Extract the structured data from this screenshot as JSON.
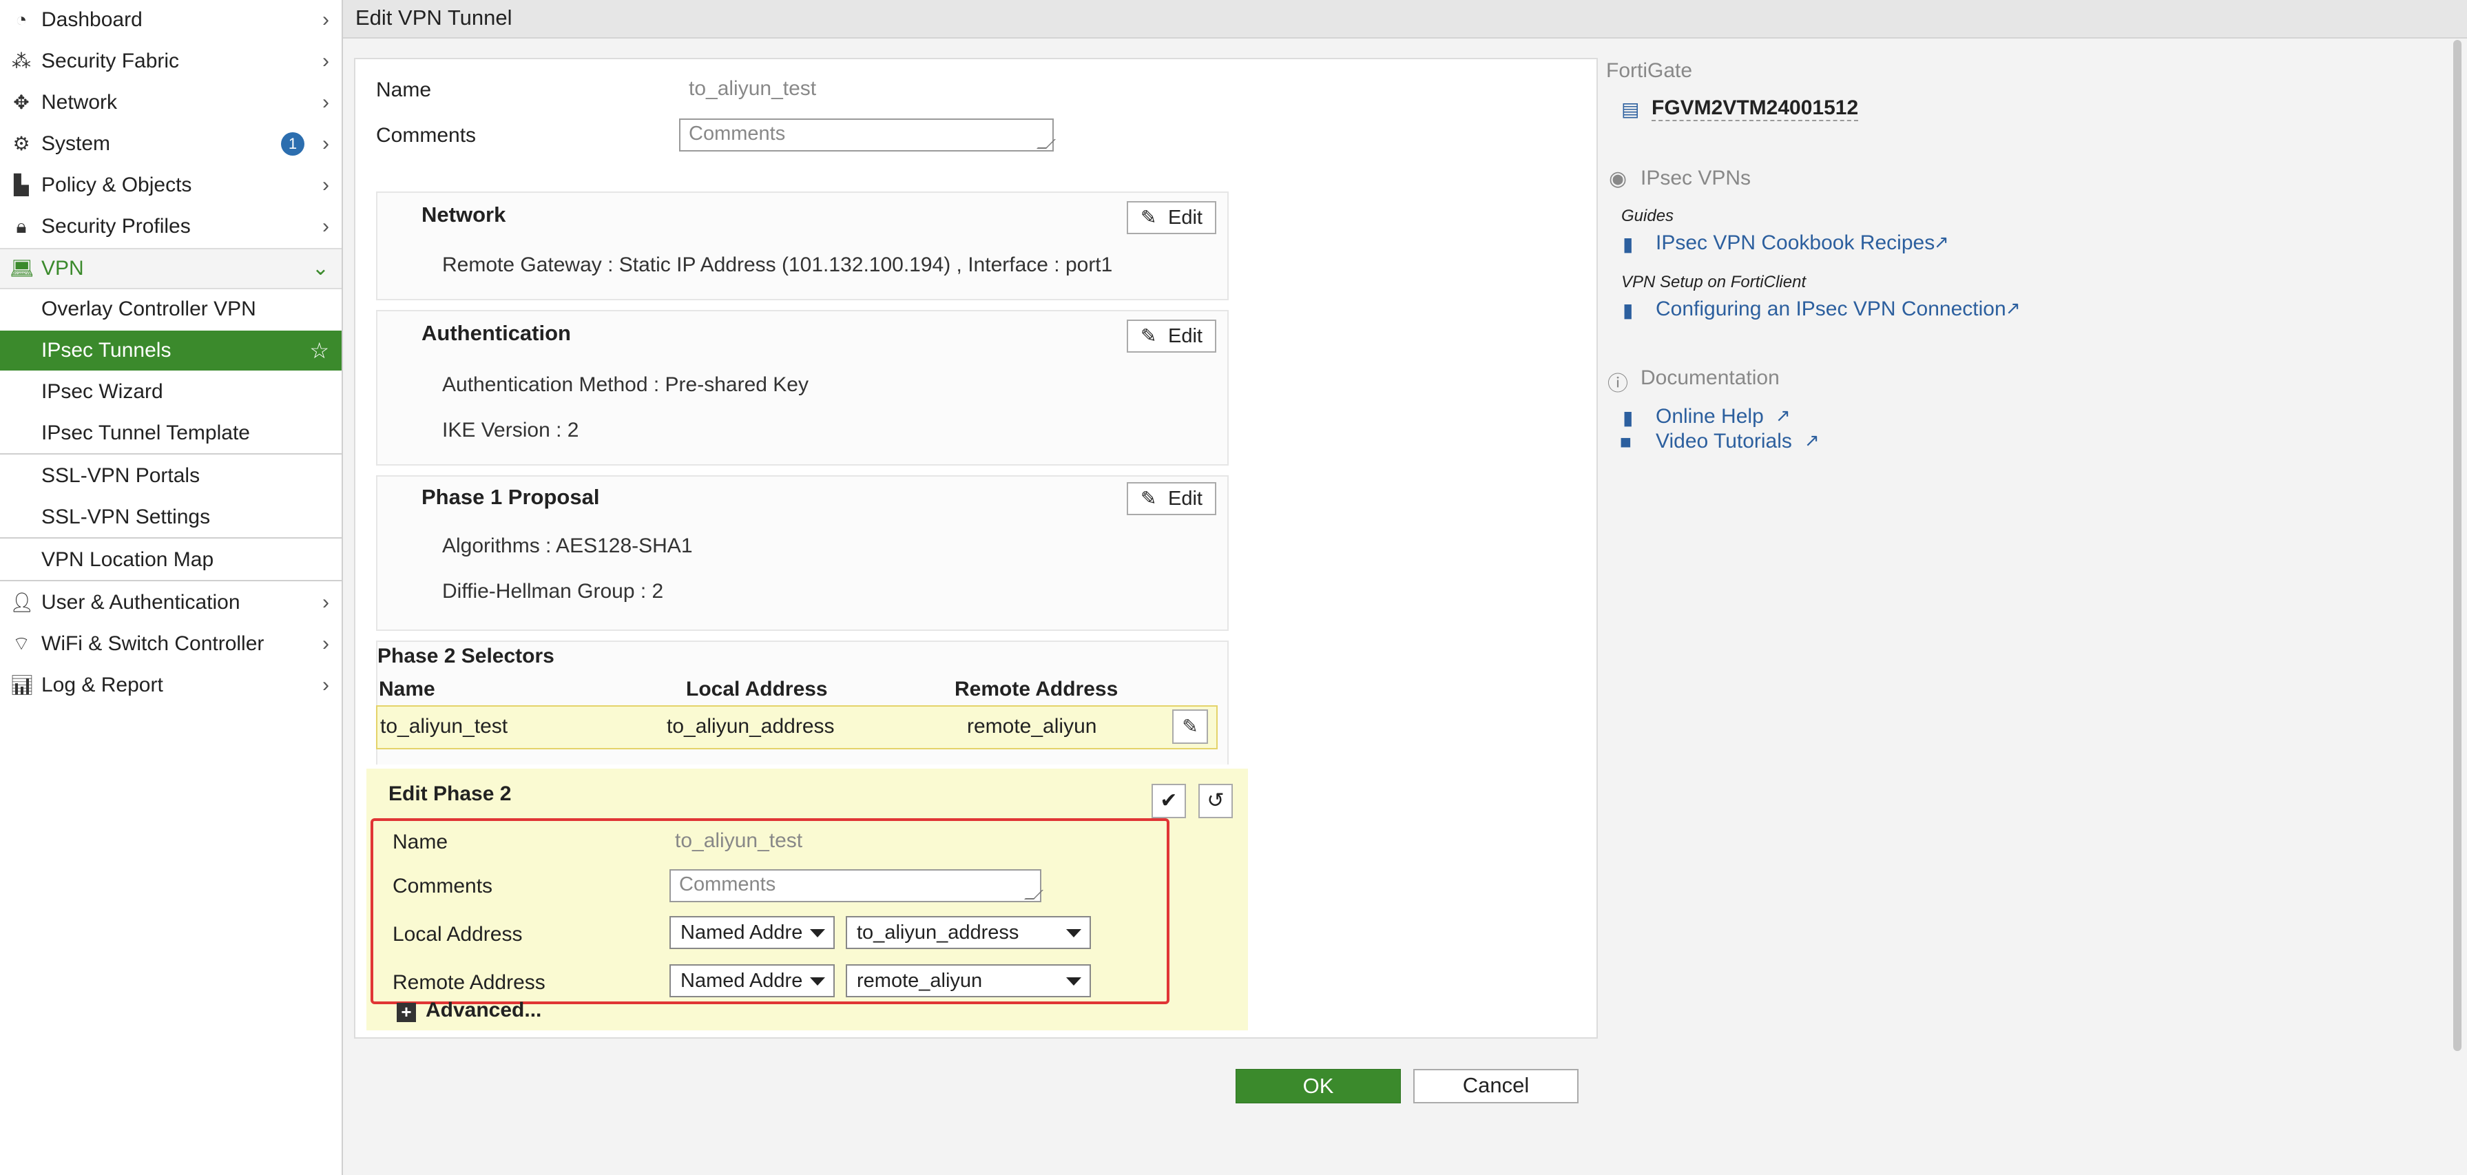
{
  "sidebar": {
    "items": [
      {
        "label": "Dashboard",
        "icon": "dashboard-icon"
      },
      {
        "label": "Security Fabric",
        "icon": "fabric-icon"
      },
      {
        "label": "Network",
        "icon": "network-icon"
      },
      {
        "label": "System",
        "icon": "gear-icon",
        "badge": "1"
      },
      {
        "label": "Policy & Objects",
        "icon": "policy-icon"
      },
      {
        "label": "Security Profiles",
        "icon": "lock-icon"
      },
      {
        "label": "VPN",
        "icon": "laptop-icon"
      }
    ],
    "vpn_sub": [
      {
        "label": "Overlay Controller VPN"
      },
      {
        "label": "IPsec Tunnels"
      },
      {
        "label": "IPsec Wizard"
      },
      {
        "label": "IPsec Tunnel Template"
      },
      {
        "label": "SSL-VPN Portals"
      },
      {
        "label": "SSL-VPN Settings"
      },
      {
        "label": "VPN Location Map"
      }
    ],
    "bottom_items": [
      {
        "label": "User & Authentication",
        "icon": "user-icon"
      },
      {
        "label": "WiFi & Switch Controller",
        "icon": "wifi-icon"
      },
      {
        "label": "Log & Report",
        "icon": "chart-icon"
      }
    ]
  },
  "header": {
    "title": "Edit VPN Tunnel"
  },
  "form": {
    "name_label": "Name",
    "name_value": "to_aliyun_test",
    "comments_label": "Comments",
    "comments_placeholder": "Comments"
  },
  "sections": {
    "network": {
      "title": "Network",
      "rows": [
        "Remote Gateway : Static IP Address (101.132.100.194) , Interface : port1"
      ],
      "edit": "Edit"
    },
    "authentication": {
      "title": "Authentication",
      "rows": [
        "Authentication Method : Pre-shared Key",
        "IKE Version : 2"
      ],
      "edit": "Edit"
    },
    "phase1": {
      "title": "Phase 1 Proposal",
      "rows": [
        "Algorithms : AES128-SHA1",
        "Diffie-Hellman Group : 2"
      ],
      "edit": "Edit"
    }
  },
  "phase2": {
    "title": "Phase 2 Selectors",
    "columns": [
      "Name",
      "Local Address",
      "Remote Address"
    ],
    "row": {
      "name": "to_aliyun_test",
      "local": "to_aliyun_address",
      "remote": "remote_aliyun"
    }
  },
  "edit_phase2": {
    "title": "Edit Phase 2",
    "name_label": "Name",
    "name_value": "to_aliyun_test",
    "comments_label": "Comments",
    "comments_placeholder": "Comments",
    "local_label": "Local Address",
    "local_type": "Named Addre",
    "local_value": "to_aliyun_address",
    "remote_label": "Remote Address",
    "remote_type": "Named Addre",
    "remote_value": "remote_aliyun",
    "advanced": "Advanced..."
  },
  "buttons": {
    "ok": "OK",
    "cancel": "Cancel"
  },
  "right_panel": {
    "heading": "FortiGate",
    "device": "FGVM2VTM24001512",
    "ipsec_heading": "IPsec VPNs",
    "guides_label": "Guides",
    "guide_link": "IPsec VPN Cookbook Recipes",
    "forticlient_label": "VPN Setup on FortiClient",
    "forticlient_link": "Configuring an IPsec VPN Connection",
    "docs_heading": "Documentation",
    "online_help": "Online Help",
    "video_tutorials": "Video Tutorials"
  },
  "colors": {
    "accent": "#3b8a2c",
    "link": "#2c5f9e",
    "highlight": "#fafad2",
    "alert": "#e03535"
  }
}
